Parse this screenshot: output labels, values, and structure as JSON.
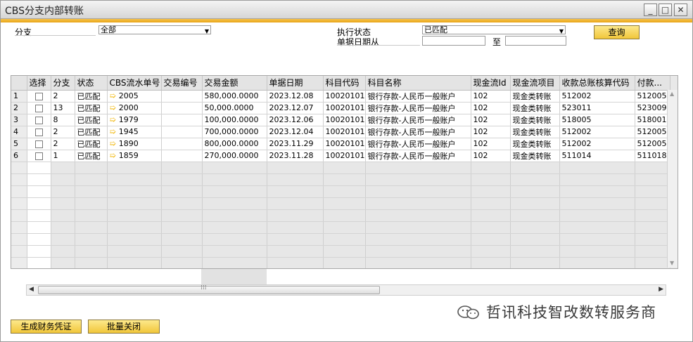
{
  "window": {
    "title": "CBS分支内部转账"
  },
  "titlebar_buttons": {
    "minimize": "_",
    "maximize": "□",
    "close": "✕"
  },
  "form": {
    "branch_label": "分支",
    "branch_value": "全部",
    "exec_status_label": "执行状态",
    "exec_status_value": "已匹配",
    "doc_date_label": "单据日期从",
    "doc_date_from": "",
    "to_label": "至",
    "doc_date_to": "",
    "query_button": "查询"
  },
  "grid": {
    "columns": [
      "",
      "选择",
      "分支",
      "状态",
      "CBS流水单号",
      "交易编号",
      "交易金额",
      "单据日期",
      "科目代码",
      "科目名称",
      "现金流Id",
      "现金流项目",
      "收款总账核算代码",
      "付款..."
    ],
    "rows": [
      {
        "no": "1",
        "branch": "2",
        "status": "已匹配",
        "cbs_no": "2005",
        "trade_no": "",
        "amount": "580,000.0000",
        "date": "2023.12.08",
        "acct_code": "10020101",
        "acct_name": "银行存款-人民币一般账户",
        "cf_id": "102",
        "cf_item": "现金类转账",
        "recv_code": "512002",
        "pay_code": "512005"
      },
      {
        "no": "2",
        "branch": "13",
        "status": "已匹配",
        "cbs_no": "2000",
        "trade_no": "",
        "amount": "50,000.0000",
        "date": "2023.12.07",
        "acct_code": "10020101",
        "acct_name": "银行存款-人民币一般账户",
        "cf_id": "102",
        "cf_item": "现金类转账",
        "recv_code": "523011",
        "pay_code": "523009"
      },
      {
        "no": "3",
        "branch": "8",
        "status": "已匹配",
        "cbs_no": "1979",
        "trade_no": "",
        "amount": "100,000.0000",
        "date": "2023.12.06",
        "acct_code": "10020101",
        "acct_name": "银行存款-人民币一般账户",
        "cf_id": "102",
        "cf_item": "现金类转账",
        "recv_code": "518005",
        "pay_code": "518001"
      },
      {
        "no": "4",
        "branch": "2",
        "status": "已匹配",
        "cbs_no": "1945",
        "trade_no": "",
        "amount": "700,000.0000",
        "date": "2023.12.04",
        "acct_code": "10020101",
        "acct_name": "银行存款-人民币一般账户",
        "cf_id": "102",
        "cf_item": "现金类转账",
        "recv_code": "512002",
        "pay_code": "512005"
      },
      {
        "no": "5",
        "branch": "2",
        "status": "已匹配",
        "cbs_no": "1890",
        "trade_no": "",
        "amount": "800,000.0000",
        "date": "2023.11.29",
        "acct_code": "10020101",
        "acct_name": "银行存款-人民币一般账户",
        "cf_id": "102",
        "cf_item": "现金类转账",
        "recv_code": "512002",
        "pay_code": "512005"
      },
      {
        "no": "6",
        "branch": "1",
        "status": "已匹配",
        "cbs_no": "1859",
        "trade_no": "",
        "amount": "270,000.0000",
        "date": "2023.11.28",
        "acct_code": "10020101",
        "acct_name": "银行存款-人民币一般账户",
        "cf_id": "102",
        "cf_item": "现金类转账",
        "recv_code": "511014",
        "pay_code": "511018"
      }
    ]
  },
  "footer": {
    "gen_voucher_button": "生成财务凭证",
    "batch_close_button": "批量关闭"
  },
  "watermark": {
    "text": "哲讯科技智改数转服务商"
  },
  "colors": {
    "accent": "#f0b400",
    "button_bg": "#f4cf4a",
    "grid_empty": "#e7e7e7"
  }
}
